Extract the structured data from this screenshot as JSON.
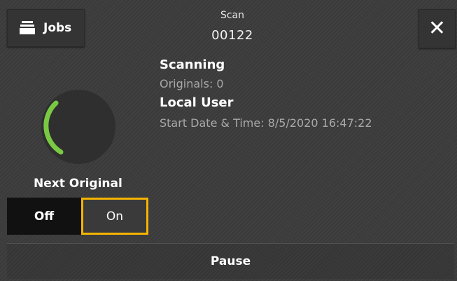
{
  "header": {
    "jobs_label": "Jobs",
    "title": "Scan",
    "job_number": "00122"
  },
  "status": {
    "state": "Scanning",
    "originals": "Originals: 0",
    "user": "Local User",
    "start_time": "Start Date & Time: 8/5/2020 16:47:22"
  },
  "next_original": {
    "label": "Next Original",
    "off_label": "Off",
    "on_label": "On",
    "selected": "On"
  },
  "footer": {
    "pause_label": "Pause"
  },
  "colors": {
    "progress": "#7ac943",
    "selection_border": "#f4b400"
  },
  "icons": {
    "jobs": "jobs-stack-icon",
    "close": "close-icon"
  }
}
